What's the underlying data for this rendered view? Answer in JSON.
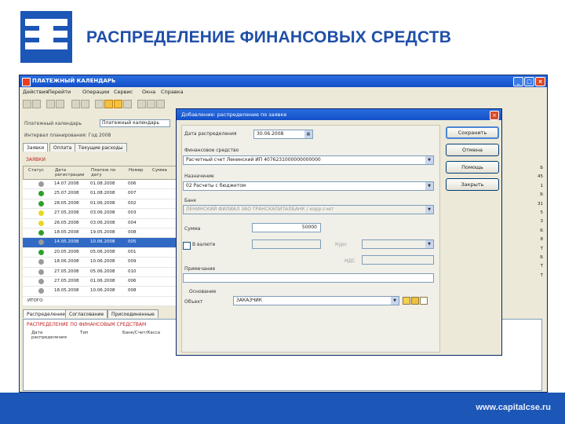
{
  "slide": {
    "title": "РАСПРЕДЕЛЕНИЕ ФИНАНСОВЫХ СРЕДСТВ",
    "footer_url": "www.capitalcse.ru"
  },
  "app": {
    "title": "ПЛАТЕЖНЫЙ КАЛЕНДАРЬ",
    "menu": [
      "Действия",
      "Перейти",
      "Операции",
      "Сервис",
      "Окна",
      "Справка"
    ],
    "calendar_label": "Платежный календарь",
    "calendar_value": "Платежный календарь",
    "filter_label": "Интервал планирования: Год 2008",
    "tabs": [
      "Заявки",
      "Оплата",
      "Текущие расходы"
    ],
    "grid_title": "ЗАЯВКИ",
    "grid_headers": [
      "Статус",
      "Дата регистрации",
      "Платеж по дату",
      "Номер",
      "Сумма"
    ],
    "rows": [
      {
        "date1": "14.07.2008",
        "date2": "01.08.2008",
        "num": "006",
        "status": "#9a9a9a"
      },
      {
        "date1": "25.07.2008",
        "date2": "01.08.2008",
        "num": "007",
        "status": "#2ea02a"
      },
      {
        "date1": "28.05.2008",
        "date2": "01.06.2008",
        "num": "002",
        "status": "#2ea02a"
      },
      {
        "date1": "27.05.2008",
        "date2": "03.06.2008",
        "num": "003",
        "status": "#e8d820"
      },
      {
        "date1": "26.05.2008",
        "date2": "03.06.2008",
        "num": "004",
        "status": "#e8d820"
      },
      {
        "date1": "18.05.2008",
        "date2": "19.05.2008",
        "num": "008",
        "status": "#2ea02a"
      },
      {
        "date1": "14.05.2008",
        "date2": "10.06.2008",
        "num": "005",
        "status": "#9a9a9a"
      },
      {
        "date1": "20.05.2008",
        "date2": "05.06.2008",
        "num": "001",
        "status": "#2ea02a"
      },
      {
        "date1": "18.06.2008",
        "date2": "10.06.2008",
        "num": "009",
        "status": "#9a9a9a"
      },
      {
        "date1": "27.05.2008",
        "date2": "05.06.2008",
        "num": "010",
        "status": "#9a9a9a"
      },
      {
        "date1": "27.05.2008",
        "date2": "01.06.2008",
        "num": "006",
        "status": "#9a9a9a"
      },
      {
        "date1": "18.05.2008",
        "date2": "10.06.2008",
        "num": "008",
        "status": "#9a9a9a"
      }
    ],
    "total_label": "ИТОГО",
    "bottom_tabs": [
      "Распределение",
      "Согласование",
      "Присоединенные"
    ],
    "bottom_title": "РАСПРЕДЕЛЕНИЕ ПО ФИНАНСОВЫМ СРЕДСТВАМ",
    "bottom_headers": [
      "Дата распределения",
      "Тип",
      "Банк/Счет/Касса"
    ],
    "right_values": [
      "Б",
      "45",
      "1",
      "Б",
      "31",
      "5",
      "3",
      "Б",
      "8",
      "Т",
      "Б",
      "Т",
      "Т"
    ]
  },
  "dialog": {
    "title": "Добавление: распределение по заявке",
    "date_label": "Дата распределения",
    "date_value": "30.06.2008",
    "fin_label": "Финансовое средство",
    "fin_value": "Расчетный счет Ленинский ИП 4076231000000000000",
    "nom_label": "Назначение",
    "nom_value": "02 Расчеты с бюджетом",
    "bank_label": "Банк",
    "bank_value": "ЛЕНИНСКИЙ ФИЛИАЛ ЗАО ТРАНСКАПИТАЛБАНК / корр.счет",
    "sum_label": "Сумма",
    "sum_value": "50000",
    "currency_label": "В валюте",
    "rate_label": "Курс",
    "nds_label": "НДС",
    "purpose_label": "Примечание",
    "basis_label": "Основание",
    "object_label": "Объект",
    "object_value": "ЗАКАЗЧИК",
    "buttons": {
      "save": "Сохранить",
      "cancel": "Отмена",
      "help": "Помощь",
      "close": "Закрыть"
    }
  }
}
